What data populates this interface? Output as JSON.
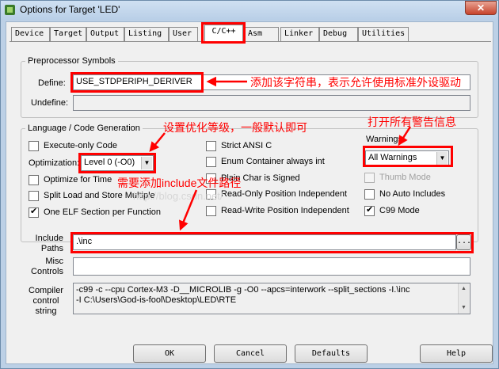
{
  "window": {
    "title": "Options for Target 'LED'",
    "close_label": "✕"
  },
  "tabs": [
    "Device",
    "Target",
    "Output",
    "Listing",
    "User",
    "C/C++",
    "Asm",
    "Linker",
    "Debug",
    "Utilities"
  ],
  "preprocessor": {
    "group_label": "Preprocessor Symbols",
    "define_label": "Define:",
    "define_value": "USE_STDPERIPH_DERIVER",
    "undefine_label": "Undefine:",
    "undefine_value": ""
  },
  "language": {
    "group_label": "Language / Code Generation",
    "execute_only": "Execute-only Code",
    "optimization_label": "Optimization:",
    "optimization_value": "Level 0 (-O0)",
    "optimize_time": "Optimize for Time",
    "split_load": "Split Load and Store Multiple",
    "one_elf": "One ELF Section per Function",
    "strict_ansi": "Strict ANSI C",
    "enum_container": "Enum Container always int",
    "plain_char": "Plain Char is Signed",
    "ro_pos": "Read-Only Position Independent",
    "rw_pos": "Read-Write Position Independent",
    "warnings_label": "Warnings:",
    "warnings_value": "All Warnings",
    "thumb_mode": "Thumb Mode",
    "no_auto_includes": "No Auto Includes",
    "c99_mode": "C99 Mode"
  },
  "include": {
    "label": "Include Paths",
    "value": ".\\inc",
    "browse": "..."
  },
  "misc": {
    "label": "Misc Controls",
    "value": ""
  },
  "compiler": {
    "label": "Compiler control string",
    "line1": "-c99 -c --cpu Cortex-M3 -D__MICROLIB -g -O0 --apcs=interwork --split_sections -I.\\inc",
    "line2": "-I C:\\Users\\God-is-fool\\Desktop\\LED\\RTE"
  },
  "buttons": {
    "ok": "OK",
    "cancel": "Cancel",
    "defaults": "Defaults",
    "help": "Help"
  },
  "annotations": {
    "define_note": "添加该字符串，表示允许使用标准外设驱动",
    "optimization_note": "设置优化等级，一般默认即可",
    "warnings_note": "打开所有警告信息",
    "include_note": "需要添加include文件路径"
  },
  "watermark": "http://blog.csdn.net/",
  "colors": {
    "annotation": "#ff0000",
    "title_bar": "#bcd0e6"
  }
}
